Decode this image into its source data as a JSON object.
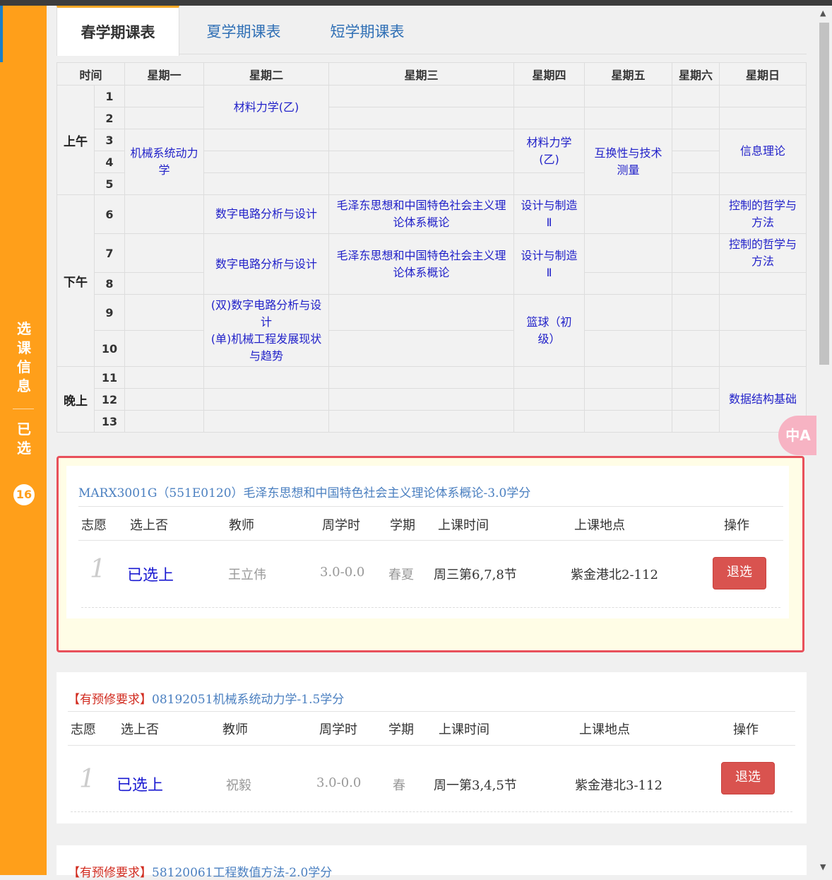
{
  "sidebar": {
    "info_label": "选课信息",
    "selected_label": "已选",
    "selected_count": "16"
  },
  "tabs": [
    {
      "label": "春学期课表",
      "active": true
    },
    {
      "label": "夏学期课表",
      "active": false
    },
    {
      "label": "短学期课表",
      "active": false
    }
  ],
  "timetable": {
    "headers": [
      "时间",
      "星期一",
      "星期二",
      "星期三",
      "星期四",
      "星期五",
      "星期六",
      "星期日"
    ],
    "periods": [
      "上午",
      "下午",
      "晚上"
    ],
    "slots": [
      "1",
      "2",
      "3",
      "4",
      "5",
      "6",
      "7",
      "8",
      "9",
      "10",
      "11",
      "12",
      "13"
    ],
    "courses": {
      "tue_1_2": "材料力学(乙)",
      "mon_3_5": "机械系统动力学",
      "thu_3_4": "材料力学(乙)",
      "fri_3_5": "互换性与技术测量",
      "sun_3_4": "信息理论",
      "tue_6": "数字电路分析与设计",
      "wed_6": "毛泽东思想和中国特色社会主义理论体系概论",
      "thu_6": "设计与制造Ⅱ",
      "sun_6": "控制的哲学与方法",
      "tue_7_8": "数字电路分析与设计",
      "wed_7_8": "毛泽东思想和中国特色社会主义理论体系概论",
      "thu_7_8": "设计与制造Ⅱ",
      "sun_7": "控制的哲学与方法",
      "tue_9_10a": "(双)数字电路分析与设计",
      "tue_9_10b": "(单)机械工程发展现状与趋势",
      "thu_9_10": "篮球（初级）",
      "sun_11_13": "数据结构基础"
    }
  },
  "columns": {
    "pref": "志愿",
    "status": "选上否",
    "teacher": "教师",
    "hours": "周学时",
    "term": "学期",
    "time": "上课时间",
    "place": "上课地点",
    "action": "操作"
  },
  "courses": [
    {
      "prefix": "",
      "title": "MARX3001G（551E0120）毛泽东思想和中国特色社会主义理论体系概论-3.0学分",
      "pref": "1",
      "status": "已选上",
      "teacher": "王立伟",
      "hours": "3.0-0.0",
      "term": "春夏",
      "time": "周三第6,7,8节",
      "place": "紫金港北2-112",
      "action": "退选"
    },
    {
      "prefix": "【有预修要求】",
      "title": "08192051机械系统动力学-1.5学分",
      "pref": "1",
      "status": "已选上",
      "teacher": "祝毅",
      "hours": "3.0-0.0",
      "term": "春",
      "time": "周一第3,4,5节",
      "place": "紫金港北3-112",
      "action": "退选"
    },
    {
      "prefix": "【有预修要求】",
      "title": "58120061工程数值方法-2.0学分"
    }
  ],
  "translate_label": "中A"
}
